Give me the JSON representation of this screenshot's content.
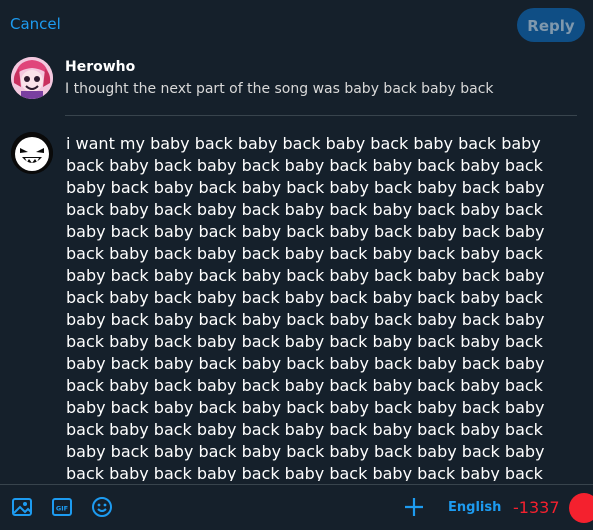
{
  "header": {
    "cancel_label": "Cancel",
    "reply_label": "Reply"
  },
  "original_tweet": {
    "author": "Herowho",
    "text": "I thought the next part of the song was baby back baby back"
  },
  "compose": {
    "text": "i want my baby back baby back baby back baby back baby back baby back baby back baby back baby back baby back baby back baby back baby back baby back baby back baby back baby back baby back baby back baby back baby back baby back baby back baby back baby back baby back baby back baby back baby back baby back baby back baby back baby back baby back baby back baby back baby back baby back baby back baby back baby back baby back baby back baby back baby back baby back baby back baby back baby back baby back baby back baby back baby back baby back baby back baby back baby back baby back baby back baby back baby back baby back baby back baby back baby back baby back baby back baby back baby back baby back baby back baby back baby back baby back baby back baby back baby back baby back baby back baby back baby back baby back baby back baby back baby back baby back baby back baby back baby back baby back baby back baby back baby back baby back baby back baby back baby back baby back baby back baby back baby back baby back baby back baby back baby back baby back baby back baby back baby back baby back baby back baby back baby back baby back baby back baby back baby back baby back baby back baby back baby back baby back baby back baby back baby back baby back baby back baby back baby back baby back baby back baby back baby back baby back baby back baby back baby back baby back baby back"
  },
  "toolbar": {
    "icons": [
      "image-icon",
      "gif-icon",
      "emoji-icon",
      "add-icon"
    ],
    "gif_label": "GIF",
    "language": "English",
    "char_counter": "-1337",
    "progress_fraction": 1.0
  },
  "colors": {
    "background": "#15202b",
    "accent": "#1d9bf0",
    "reply_button": "#0f4e85",
    "error": "#f4212e",
    "divider": "#38444d"
  }
}
